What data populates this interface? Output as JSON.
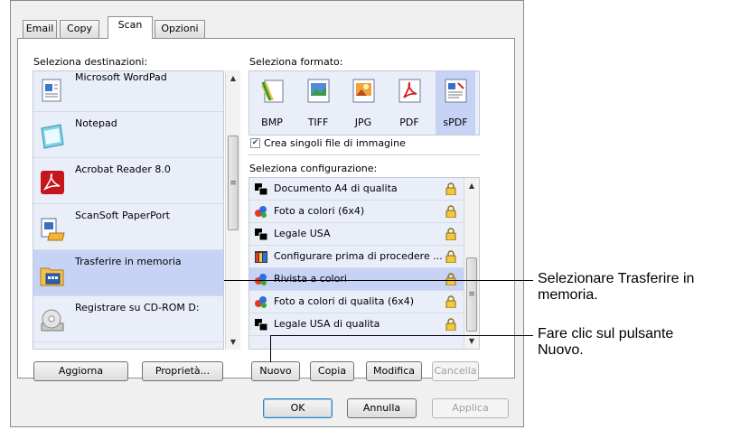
{
  "tabs": [
    {
      "label": "Email"
    },
    {
      "label": "Copy"
    },
    {
      "label": "Scan",
      "active": true
    },
    {
      "label": "Opzioni"
    }
  ],
  "destinations": {
    "heading": "Seleziona destinazioni:",
    "items": [
      {
        "label": "Microsoft WordPad",
        "icon": "wordpad-icon"
      },
      {
        "label": "Notepad",
        "icon": "notepad-icon"
      },
      {
        "label": "Acrobat Reader 8.0",
        "icon": "acrobat-icon"
      },
      {
        "label": "ScanSoft PaperPort",
        "icon": "paperport-icon"
      },
      {
        "label": "Trasferire in memoria",
        "icon": "folder-icon",
        "selected": true
      },
      {
        "label": "Registrare su CD-ROM  D:",
        "icon": "cdrom-icon"
      }
    ]
  },
  "format": {
    "heading": "Seleziona formato:",
    "items": [
      {
        "label": "BMP",
        "icon": "bmp-icon"
      },
      {
        "label": "TIFF",
        "icon": "tiff-icon"
      },
      {
        "label": "JPG",
        "icon": "jpg-icon"
      },
      {
        "label": "PDF",
        "icon": "pdf-icon"
      },
      {
        "label": "sPDF",
        "icon": "spdf-icon",
        "selected": true
      }
    ],
    "checkbox_label": "Crea singoli file di immagine",
    "checkbox_checked": true
  },
  "configuration": {
    "heading": "Seleziona configurazione:",
    "items": [
      {
        "label": "Documento A4 di qualita",
        "icon": "bw-document-icon"
      },
      {
        "label": "Foto a colori (6x4)",
        "icon": "color-photo-icon"
      },
      {
        "label": "Legale USA",
        "icon": "bw-document-icon"
      },
      {
        "label": "Configurare prima di procedere ...",
        "icon": "configure-icon"
      },
      {
        "label": "Rivista a colori",
        "icon": "color-photo-icon",
        "selected": true
      },
      {
        "label": "Foto a colori di qualita (6x4)",
        "icon": "color-photo-icon"
      },
      {
        "label": "Legale USA di qualita",
        "icon": "bw-document-icon"
      }
    ]
  },
  "buttons": {
    "aggiorna": "Aggiorna",
    "proprieta": "Proprietà...",
    "nuovo": "Nuovo",
    "copia": "Copia",
    "modifica": "Modifica",
    "cancella": "Cancella",
    "ok": "OK",
    "annulla": "Annulla",
    "applica": "Applica"
  },
  "callouts": {
    "first_line1": "Selezionare Trasferire in",
    "first_line2": "memoria.",
    "second_line1": "Fare clic sul pulsante",
    "second_line2": "Nuovo."
  },
  "colors": {
    "list_bg": "#e9eef8",
    "selection": "#c6d3f5",
    "window_bg": "#f0f0f0"
  }
}
